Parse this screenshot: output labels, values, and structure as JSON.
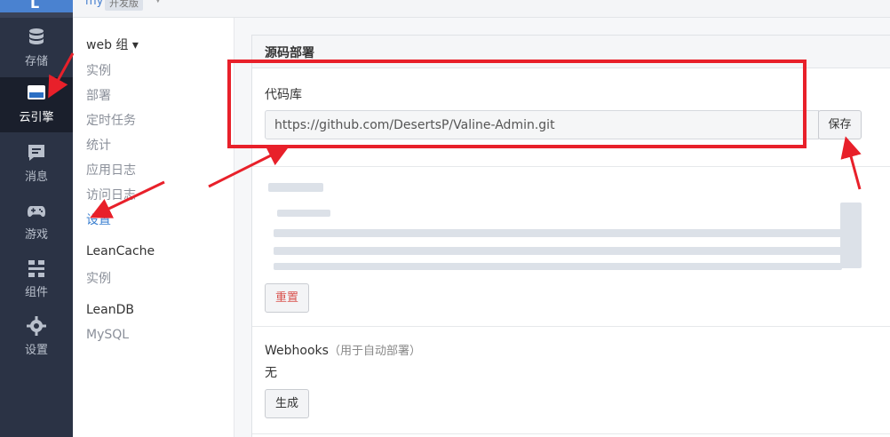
{
  "rail": {
    "logo_letter": "L",
    "items": [
      {
        "label": "存储",
        "icon": "database-icon"
      },
      {
        "label": "云引擎",
        "icon": "server-icon",
        "active": true
      },
      {
        "label": "消息",
        "icon": "message-icon"
      },
      {
        "label": "游戏",
        "icon": "gamepad-icon"
      },
      {
        "label": "组件",
        "icon": "components-icon"
      },
      {
        "label": "设置",
        "icon": "gear-icon"
      }
    ]
  },
  "topbar": {
    "app_name": "my",
    "app_badge": "开发版"
  },
  "subnav": {
    "groups": [
      {
        "title": "web 组 ▾",
        "items": [
          "实例",
          "部署",
          "定时任务",
          "统计",
          "应用日志",
          "访问日志",
          "设置"
        ],
        "active_index": 6
      },
      {
        "title": "LeanCache",
        "items": [
          "实例"
        ]
      },
      {
        "title": "LeanDB",
        "items": [
          "MySQL"
        ]
      }
    ]
  },
  "main": {
    "panel_title": "源码部署",
    "repo": {
      "label": "代码库",
      "value": "https://github.com/DesertsP/Valine-Admin.git",
      "save_label": "保存"
    },
    "reset_label": "重置",
    "webhooks": {
      "label": "Webhooks",
      "note": "（用于自动部署）",
      "value": "无",
      "generate_label": "生成"
    }
  },
  "colors": {
    "accent": "#3a7fd0",
    "annotation": "#e8202a",
    "danger_text": "#d9534f"
  }
}
